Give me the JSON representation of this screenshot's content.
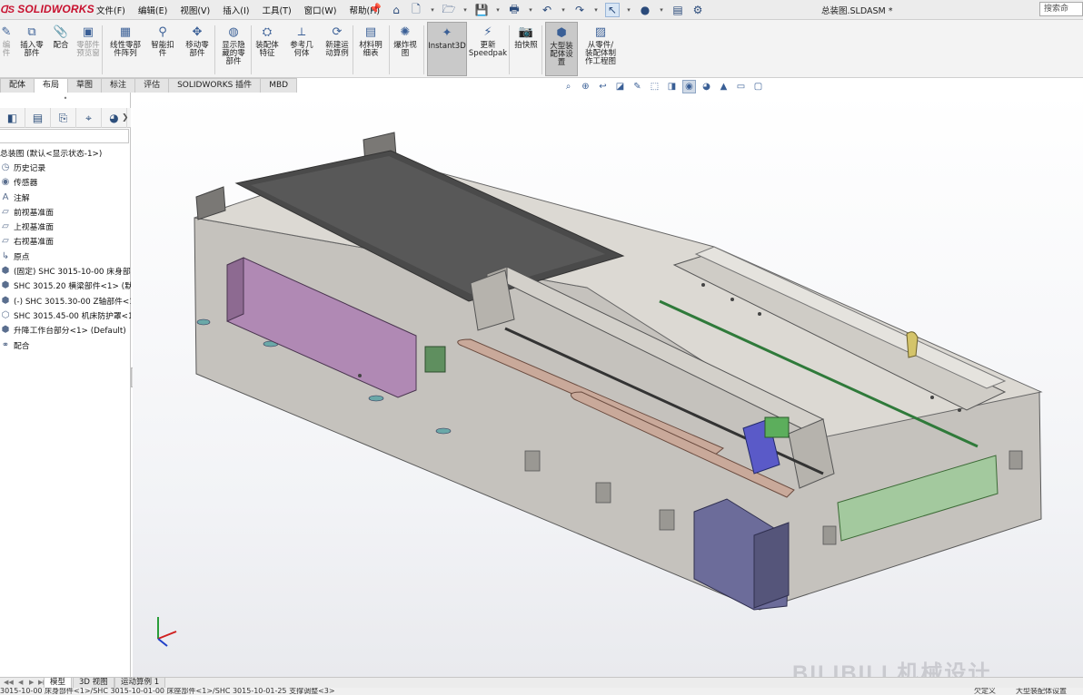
{
  "app": {
    "brand": "SOLIDWORKS",
    "document_title": "总装图.SLDASM *",
    "search_placeholder": "搜索命"
  },
  "menu": [
    "文件(F)",
    "编辑(E)",
    "视图(V)",
    "插入(I)",
    "工具(T)",
    "窗口(W)",
    "帮助(H)"
  ],
  "quickbar": [
    {
      "icon": "home-icon",
      "glyph": "⌂"
    },
    {
      "icon": "new-document-icon",
      "glyph": "🗋"
    },
    {
      "icon": "open-folder-icon",
      "glyph": "🗁"
    },
    {
      "icon": "save-icon",
      "glyph": "💾"
    },
    {
      "icon": "print-icon",
      "glyph": "🖶"
    },
    {
      "icon": "undo-icon",
      "glyph": "↶"
    },
    {
      "icon": "redo-icon",
      "glyph": "↷"
    },
    {
      "icon": "select-pointer-icon",
      "glyph": "↖"
    },
    {
      "icon": "traffic-light-icon",
      "glyph": "●"
    },
    {
      "icon": "file-properties-icon",
      "glyph": "▤"
    },
    {
      "icon": "options-gear-icon",
      "glyph": "⚙"
    }
  ],
  "commands": [
    {
      "name": "cmd-edit-component",
      "label": "编\n件",
      "dim": true,
      "icon": "edit-component-icon",
      "glyph": "✎"
    },
    {
      "name": "cmd-insert-components",
      "label": "插入零\n部件",
      "icon": "insert-component-icon",
      "glyph": "⧉"
    },
    {
      "name": "cmd-mate",
      "label": "配合",
      "icon": "mate-paperclip-icon",
      "glyph": "📎"
    },
    {
      "name": "cmd-component-preview",
      "label": "零部件\n预览窗",
      "dim": true,
      "icon": "component-preview-icon",
      "glyph": "▣"
    },
    {
      "name": "cmd-linear-pattern",
      "label": "线性零部\n件阵列",
      "icon": "linear-pattern-icon",
      "glyph": "▦"
    },
    {
      "name": "cmd-smart-fasteners",
      "label": "智能扣\n件",
      "icon": "smart-fastener-icon",
      "glyph": "⚲"
    },
    {
      "name": "cmd-move-component",
      "label": "移动零\n部件",
      "icon": "move-component-icon",
      "glyph": "✥"
    },
    {
      "name": "cmd-show-hidden",
      "label": "显示隐\n藏的零\n部件",
      "icon": "show-hidden-icon",
      "glyph": "◍"
    },
    {
      "name": "cmd-assembly-features",
      "label": "装配体\n特征",
      "icon": "assembly-feature-icon",
      "glyph": "⛭"
    },
    {
      "name": "cmd-reference-geometry",
      "label": "参考几\n何体",
      "icon": "reference-geometry-icon",
      "glyph": "⟂"
    },
    {
      "name": "cmd-new-motion-study",
      "label": "新建运\n动算例",
      "icon": "motion-study-icon",
      "glyph": "⟳"
    },
    {
      "name": "cmd-bill-of-materials",
      "label": "材料明\n细表",
      "icon": "bom-table-icon",
      "glyph": "▤"
    },
    {
      "name": "cmd-exploded-view",
      "label": "爆炸视\n图",
      "icon": "exploded-view-icon",
      "glyph": "✺"
    },
    {
      "name": "cmd-instant3d",
      "label": "Instant3D",
      "active": true,
      "icon": "instant3d-icon",
      "glyph": "✦"
    },
    {
      "name": "cmd-update-speedpak",
      "label": "更新\nSpeedpak",
      "icon": "speedpak-icon",
      "glyph": "⚡"
    },
    {
      "name": "cmd-take-snapshot",
      "label": "拍快照",
      "icon": "camera-icon",
      "glyph": "📷"
    },
    {
      "name": "cmd-large-assembly-settings",
      "label": "大型装\n配体设\n置",
      "active": true,
      "icon": "large-assembly-icon",
      "glyph": "⬢"
    },
    {
      "name": "cmd-make-drawing",
      "label": "从零件/\n装配体制\n作工程图",
      "icon": "make-drawing-icon",
      "glyph": "▨"
    }
  ],
  "tabs": [
    "配体",
    "布局",
    "草图",
    "标注",
    "评估",
    "SOLIDWORKS 插件",
    "MBD"
  ],
  "active_tab": 1,
  "panel_tabs": [
    {
      "icon": "feature-manager-icon",
      "glyph": "◧"
    },
    {
      "icon": "property-manager-icon",
      "glyph": "▤"
    },
    {
      "icon": "configuration-manager-icon",
      "glyph": "⎘"
    },
    {
      "icon": "dimxpert-icon",
      "glyph": "⌖"
    },
    {
      "icon": "display-manager-icon",
      "glyph": "◕"
    }
  ],
  "tree": [
    {
      "label": "总装图 (默认<显示状态-1>)",
      "icon": "assembly-icon",
      "glyph": ""
    },
    {
      "label": "历史记录",
      "icon": "history-icon",
      "glyph": "◷"
    },
    {
      "label": "传感器",
      "icon": "sensor-icon",
      "glyph": "◉"
    },
    {
      "label": "注解",
      "icon": "annotation-icon",
      "glyph": "A"
    },
    {
      "label": "前视基准面",
      "icon": "plane-icon",
      "glyph": "▱"
    },
    {
      "label": "上视基准面",
      "icon": "plane-icon",
      "glyph": "▱"
    },
    {
      "label": "右视基准面",
      "icon": "plane-icon",
      "glyph": "▱"
    },
    {
      "label": "原点",
      "icon": "origin-icon",
      "glyph": "↳"
    },
    {
      "label": "(固定) SHC 3015-10-00 床身部",
      "icon": "subassembly-icon",
      "glyph": "⬢"
    },
    {
      "label": "SHC 3015.20 横梁部件<1> (默",
      "icon": "subassembly-icon",
      "glyph": "⬢"
    },
    {
      "label": "(-) SHC 3015.30-00 Z轴部件<1",
      "icon": "subassembly-icon",
      "glyph": "⬢"
    },
    {
      "label": "SHC 3015.45-00 机床防护罩<1",
      "icon": "subassembly-icon",
      "glyph": "⬡"
    },
    {
      "label": "升降工作台部分<1> (Default)",
      "icon": "subassembly-icon",
      "glyph": "⬢"
    },
    {
      "label": "配合",
      "icon": "mates-icon",
      "glyph": "⚭"
    }
  ],
  "headsup": [
    {
      "icon": "zoom-to-fit-icon",
      "glyph": "⌕"
    },
    {
      "icon": "zoom-to-area-icon",
      "glyph": "⊕"
    },
    {
      "icon": "previous-view-icon",
      "glyph": "↩"
    },
    {
      "icon": "section-view-icon",
      "glyph": "◪"
    },
    {
      "icon": "dynamic-annotation-icon",
      "glyph": "✎"
    },
    {
      "icon": "view-orientation-icon",
      "glyph": "⬚"
    },
    {
      "icon": "display-style-icon",
      "glyph": "◨"
    },
    {
      "icon": "hide-show-items-icon",
      "glyph": "◉"
    },
    {
      "icon": "edit-appearance-icon",
      "glyph": "◕"
    },
    {
      "icon": "apply-scene-icon",
      "glyph": "▲"
    },
    {
      "icon": "view-settings-icon",
      "glyph": "▭"
    },
    {
      "icon": "monitor-icon",
      "glyph": "▢"
    }
  ],
  "bottom_tabs": [
    "模型",
    "3D 视图",
    "运动算例 1"
  ],
  "status": {
    "left": "3015-10-00 床身部件<1>/SHC 3015-10-01-00 床座部件<1>/SHC 3015-10-01-25 支撑调整<3>",
    "right_a": "欠定义",
    "right_b": "大型装配体设置"
  },
  "watermark": "BILIBILI 机械设计"
}
